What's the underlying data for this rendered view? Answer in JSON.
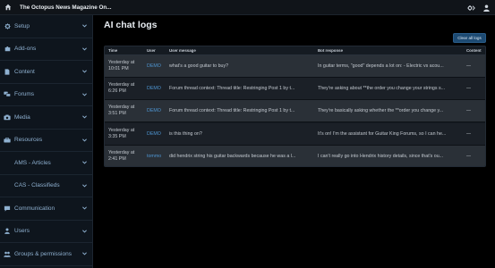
{
  "header": {
    "site_title": "The Octopus News Magazine On...",
    "home_icon": "home-icon",
    "right_icons": [
      "settings-tools-icon",
      "user-icon"
    ]
  },
  "sidebar": {
    "items": [
      {
        "label": "Setup",
        "icon": "gear-icon"
      },
      {
        "label": "Add-ons",
        "icon": "puzzle-icon"
      },
      {
        "label": "Content",
        "icon": "file-icon"
      },
      {
        "label": "Forums",
        "icon": "forums-icon"
      },
      {
        "label": "Media",
        "icon": "camera-icon"
      },
      {
        "label": "Resources",
        "icon": "resources-icon"
      },
      {
        "label": "AMS - Articles",
        "icon": "articles-icon"
      },
      {
        "label": "CAS - Classifieds",
        "icon": "classifieds-icon"
      },
      {
        "label": "Communication",
        "icon": "communication-icon"
      },
      {
        "label": "Users",
        "icon": "users-icon"
      },
      {
        "label": "Groups & permissions",
        "icon": "groups-icon"
      }
    ]
  },
  "main": {
    "title": "AI chat logs",
    "clear_button": "Clear all logs",
    "table": {
      "headers": {
        "time": "Time",
        "user": "User",
        "message": "User message",
        "response": "Bot response",
        "content": "Content"
      },
      "rows": [
        {
          "time": "Yesterday at 10:01 PM",
          "user": "DEMO",
          "message": "what's a good guitar to buy?",
          "response": "In guitar terms, \"good\" depends a lot on: - Electric vs acou...",
          "content": "—"
        },
        {
          "time": "Yesterday at 6:26 PM",
          "user": "DEMO",
          "message": "Forum thread context: Thread title: Restringing Post 1 by t...",
          "response": "They're asking about **the order you change your strings s...",
          "content": "—"
        },
        {
          "time": "Yesterday at 3:51 PM",
          "user": "DEMO",
          "message": "Forum thread context: Thread title: Restringing Post 1 by t...",
          "response": "They're basically asking whether the **order you change y...",
          "content": "—"
        },
        {
          "time": "Yesterday at 3:35 PM",
          "user": "DEMO",
          "message": "is this thing on?",
          "response": "It's on! I'm the assistant for Guitar King Forums, so I can he...",
          "content": "—"
        },
        {
          "time": "Yesterday at 2:41 PM",
          "user": "tommo",
          "message": "did hendrix string his guitar backwards because he was a l...",
          "response": "I can't really go into Hendrix history details, since that's ou...",
          "content": "—"
        }
      ]
    }
  },
  "colors": {
    "accent": "#4e95d1",
    "sidebar_bg": "#0e151d",
    "button_bg": "#1d4a72"
  }
}
